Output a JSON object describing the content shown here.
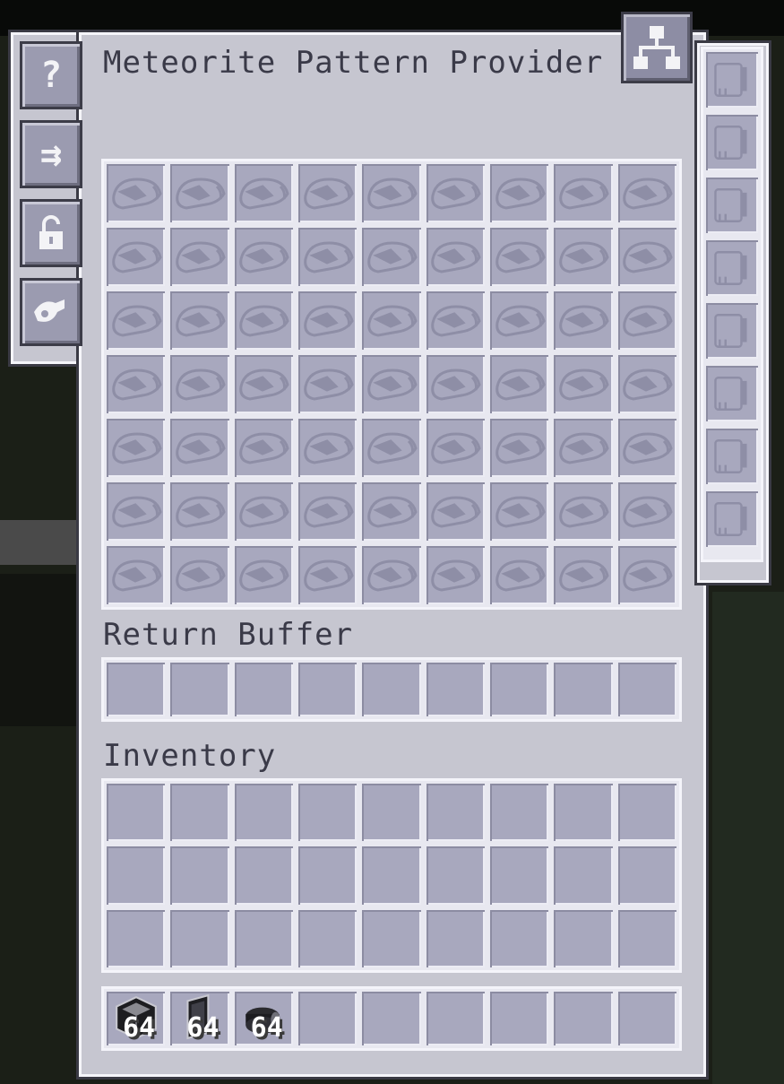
{
  "window": {
    "title": "Meteorite Pattern Provider",
    "return_buffer_label": "Return Buffer",
    "inventory_label": "Inventory"
  },
  "side_tabs": [
    {
      "name": "help-tab",
      "glyph": "?"
    },
    {
      "name": "blocking-mode-tab",
      "glyph": "⇉"
    },
    {
      "name": "lock-tab",
      "glyph": "🔓"
    },
    {
      "name": "priority-tab",
      "glyph": "⚙"
    }
  ],
  "pattern_grid": {
    "rows": 7,
    "cols": 9,
    "slot_icon": "encoded-pattern-placeholder-icon"
  },
  "upgrade_slots": {
    "count": 8,
    "slot_icon": "upgrade-card-placeholder-icon"
  },
  "return_buffer": {
    "slots": 9
  },
  "inventory": {
    "rows": 3,
    "cols": 9
  },
  "hotbar": [
    {
      "icon": "block-icon",
      "count": "64"
    },
    {
      "icon": "panel-icon",
      "count": "64"
    },
    {
      "icon": "cable-icon",
      "count": "64"
    },
    null,
    null,
    null,
    null,
    null,
    null
  ],
  "colors": {
    "panel": "#c6c6d0",
    "slot": "#a8a8be",
    "label": "#3a3a48"
  }
}
